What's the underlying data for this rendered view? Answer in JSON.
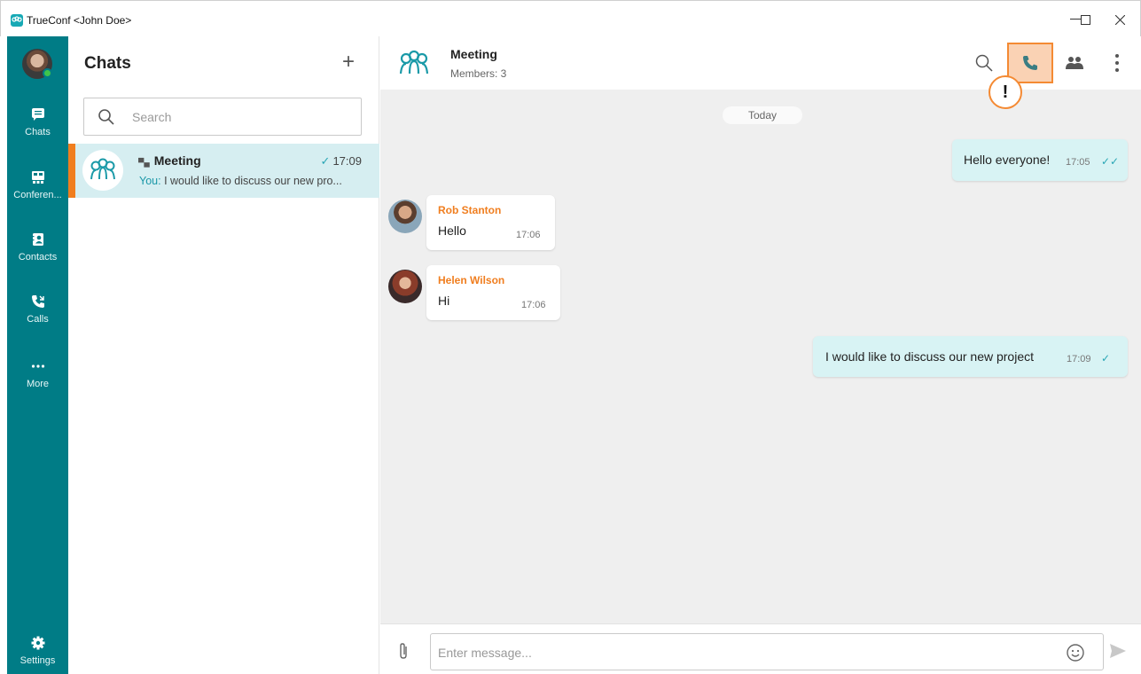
{
  "window": {
    "title": "TrueConf <John Doe>",
    "minimize_label": "—",
    "maximize_label": "☐",
    "close_label": "✕"
  },
  "rail": {
    "items": [
      {
        "label": "Chats",
        "icon": "chat-icon",
        "active": true
      },
      {
        "label": "Conferen...",
        "icon": "conference-icon"
      },
      {
        "label": "Contacts",
        "icon": "contacts-icon"
      },
      {
        "label": "Calls",
        "icon": "calls-icon"
      },
      {
        "label": "More",
        "icon": "more-icon"
      }
    ],
    "settings_label": "Settings",
    "accent_color": "#007c86"
  },
  "chat_list": {
    "header": "Chats",
    "add_label": "+",
    "search_placeholder": "Search",
    "chats": [
      {
        "name": "Meeting",
        "time": "17:09",
        "preview_sender": "You:",
        "preview_text": "I would like to discuss our new pro..."
      }
    ]
  },
  "conversation": {
    "name": "Meeting",
    "members": "Members: 3",
    "alert_mark": "!",
    "day_separator": "Today",
    "messages": [
      {
        "direction": "out",
        "text": "Hello everyone!",
        "time": "17:05",
        "read": true
      },
      {
        "direction": "in",
        "sender": "Rob Stanton",
        "text": "Hello",
        "time": "17:06"
      },
      {
        "direction": "in",
        "sender": "Helen Wilson",
        "text": "Hi",
        "time": "17:06"
      },
      {
        "direction": "out",
        "text": "I would like to discuss our new project",
        "time": "17:09",
        "read": false
      }
    ],
    "composer_placeholder": "Enter message..."
  },
  "colors": {
    "highlight_orange": "#f48a33",
    "sender_orange": "#f07e1f",
    "outgoing_bubble": "#d8f3f4",
    "selected_row": "#d6eef1"
  }
}
